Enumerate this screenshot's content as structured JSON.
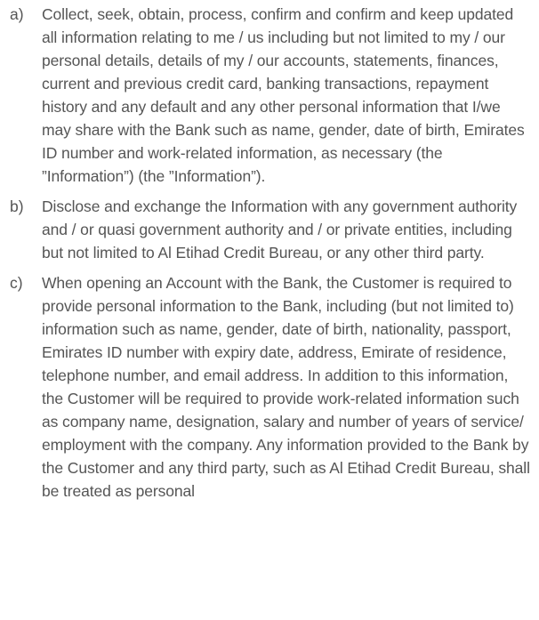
{
  "clauses": [
    {
      "marker": "a)",
      "text": "Collect, seek, obtain, process, confirm and confirm and keep updated all information relating to me / us including but not limited to my / our personal details, details of my / our accounts, statements, finances, current and previous credit card, banking transactions, repayment history and any default and any other personal information that I/we may share with the Bank such as name, gender, date of birth, Emirates ID number and work-related information, as necessary (the ”Information”) (the ”Information”)."
    },
    {
      "marker": "b)",
      "text": "Disclose and exchange the Information with any government authority and / or quasi government authority and / or private entities, including but not limited to Al Etihad Credit Bureau, or any other third party."
    },
    {
      "marker": "c)",
      "text": "When opening an Account with the Bank, the Customer is required to provide personal information to the Bank, including (but not limited to) information such as name, gender, date of birth, nationality, passport, Emirates ID number with expiry date, address, Emirate of residence, telephone number, and email address. In addition to this information, the Customer will be required to provide work-related information such as company name, designation, salary and number of years of service/ employment with the company. Any information provided to the Bank by the Customer and any third party, such as Al Etihad Credit Bureau, shall be treated as personal"
    }
  ]
}
